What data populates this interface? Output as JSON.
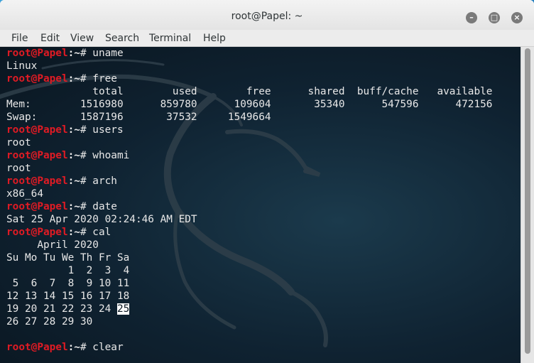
{
  "window": {
    "title": "root@Papel: ~",
    "buttons": {
      "minimize": "–",
      "maximize": "□",
      "close": "×"
    }
  },
  "menu": [
    "File",
    "Edit",
    "View",
    "Search",
    "Terminal",
    "Help"
  ],
  "prompt": {
    "host": "root@Papel",
    "path": ":~",
    "symbol": "# "
  },
  "terminal": {
    "cmd_uname": "uname",
    "out_uname": "Linux",
    "cmd_free": "free",
    "free_header": "              total        used        free      shared  buff/cache   available",
    "free_mem": "Mem:        1516980      859780      109604       35340      547596      472156",
    "free_swap": "Swap:       1587196       37532     1549664",
    "cmd_users": "users",
    "out_users": "root",
    "cmd_whoami": "whoami",
    "out_whoami": "root",
    "cmd_arch": "arch",
    "out_arch": "x86_64",
    "cmd_date": "date",
    "out_date": "Sat 25 Apr 2020 02:24:46 AM EDT",
    "cmd_cal": "cal",
    "cal_title": "     April 2020",
    "cal_days": "Su Mo Tu We Th Fr Sa",
    "cal_w1": "          1  2  3  4",
    "cal_w2": " 5  6  7  8  9 10 11",
    "cal_w3": "12 13 14 15 16 17 18",
    "cal_w4_pre": "19 20 21 22 23 24 ",
    "cal_w4_today": "25",
    "cal_w5": "26 27 28 29 30",
    "cmd_clear": "clear"
  },
  "colors": {
    "prompt_host": "#e01b24",
    "terminal_bg": "#0f2231"
  }
}
